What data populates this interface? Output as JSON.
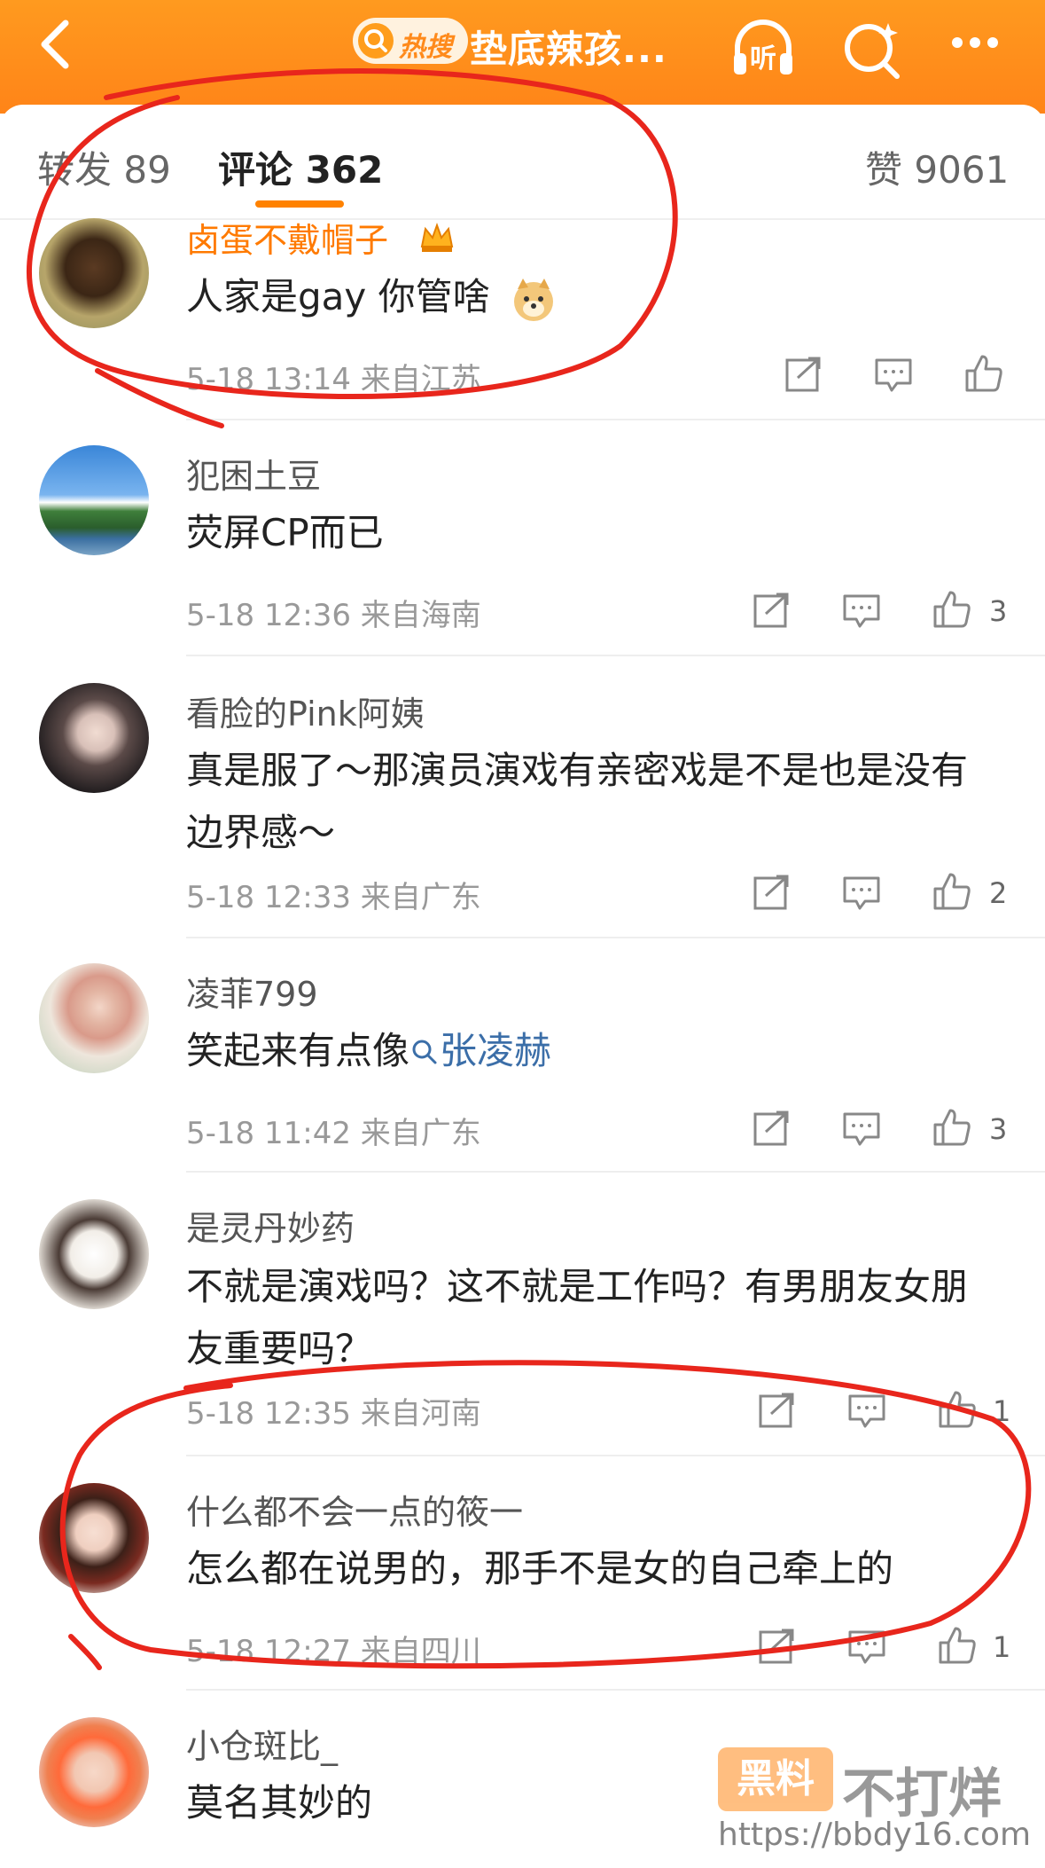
{
  "header": {
    "hot_badge": "热搜",
    "title": "垫底辣孩...",
    "listen_label": "听"
  },
  "tabs": {
    "repost": "转发 89",
    "comments": "评论 362",
    "likes": "赞 9061"
  },
  "comments": [
    {
      "user": "卤蛋不戴帽子",
      "text": "人家是gay 你管啥",
      "time": "5-18 13:14",
      "location": "来自江苏",
      "likes": ""
    },
    {
      "user": "犯困土豆",
      "text": "荧屏CP而已",
      "time": "5-18 12:36",
      "location": "来自海南",
      "likes": "3"
    },
    {
      "user": "看脸的Pink阿姨",
      "text": "真是服了～那演员演戏有亲密戏是不是也是没有边界感～",
      "time": "5-18 12:33",
      "location": "来自广东",
      "likes": "2"
    },
    {
      "user": "凌菲799",
      "text_prefix": "笑起来有点像",
      "topic": "张凌赫",
      "time": "5-18 11:42",
      "location": "来自广东",
      "likes": "3"
    },
    {
      "user": "是灵丹妙药",
      "text": "不就是演戏吗？这不就是工作吗？有男朋友女朋友重要吗？",
      "time": "5-18 12:35",
      "location": "来自河南",
      "likes": "1"
    },
    {
      "user": "什么都不会一点的筱一",
      "text": "怎么都在说男的，那手不是女的自己牵上的",
      "time": "5-18 12:27",
      "location": "来自四川",
      "likes": "1"
    },
    {
      "user": "小仓斑比_",
      "text": "莫名其妙的"
    }
  ],
  "watermark": {
    "brand": "黑料",
    "text": "不打烊",
    "url": "https://bbdy16.com"
  },
  "colors": {
    "header": "#ff8a1b",
    "accent": "#ff8200",
    "topic": "#3b6ea8",
    "annotation": "#e8261c"
  }
}
